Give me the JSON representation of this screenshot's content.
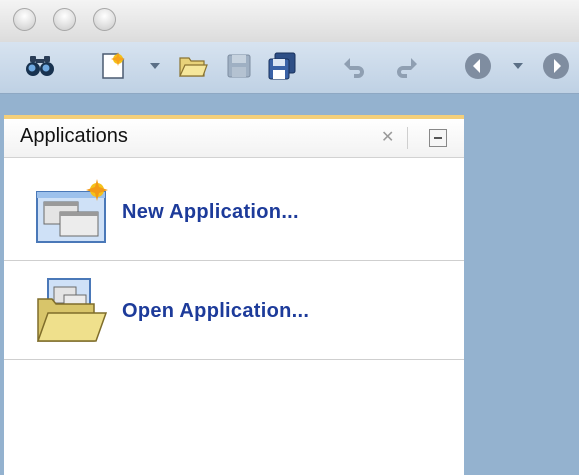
{
  "window": {
    "buttons": [
      "close-button",
      "minimize-button",
      "zoom-button"
    ]
  },
  "toolbar": {
    "icons": [
      "find-icon",
      "new-icon",
      "open-icon",
      "save-icon",
      "save-all-icon",
      "undo-icon",
      "redo-icon",
      "back-icon",
      "forward-icon"
    ]
  },
  "panel": {
    "title": "Applications",
    "items": [
      {
        "label": "New Application...",
        "icon": "new-application-icon"
      },
      {
        "label": "Open Application...",
        "icon": "open-application-icon"
      }
    ]
  }
}
